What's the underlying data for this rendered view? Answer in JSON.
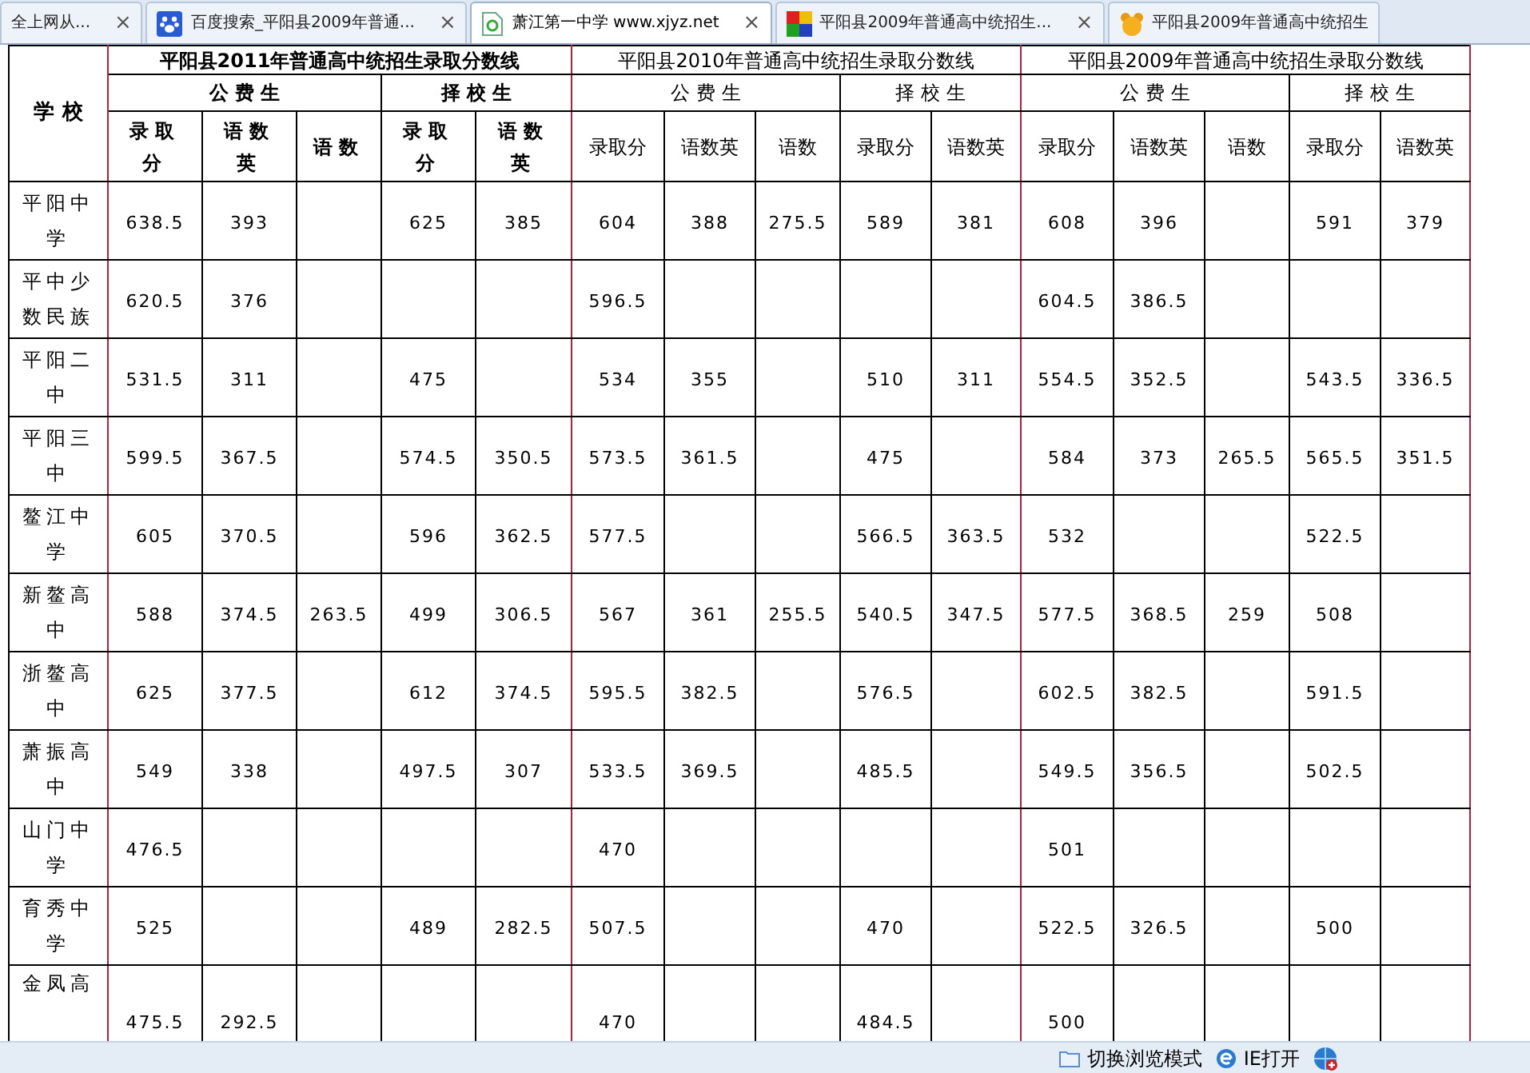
{
  "tabs": [
    {
      "label": "全上网从...",
      "kind": "none",
      "selected": false,
      "closable": true
    },
    {
      "label": "百度搜索_平阳县2009年普通...",
      "kind": "paw",
      "selected": false,
      "closable": true
    },
    {
      "label": "萧江第一中学 www.xjyz.net",
      "kind": "page",
      "selected": true,
      "closable": true
    },
    {
      "label": "平阳县2009年普通高中统招生...",
      "kind": "blocks",
      "selected": false,
      "closable": true
    },
    {
      "label": "平阳县2009年普通高中统招生",
      "kind": "bear",
      "selected": false,
      "closable": false
    }
  ],
  "close_glyph": "×",
  "table": {
    "school_header": "学 校",
    "groups": [
      {
        "title": "平阳县2011年普通高中统招生录取分数线",
        "bold": true,
        "subgroups": [
          {
            "label": "公 费 生",
            "columns": [
              "录取分",
              "语数英",
              "语数"
            ]
          },
          {
            "label": "择 校 生",
            "columns": [
              "录取分",
              "语数英"
            ]
          }
        ]
      },
      {
        "title": "平阳县2010年普通高中统招生录取分数线",
        "bold": false,
        "subgroups": [
          {
            "label": "公 费 生",
            "columns": [
              "录取分",
              "语数英",
              "语数"
            ]
          },
          {
            "label": "择 校 生",
            "columns": [
              "录取分",
              "语数英"
            ]
          }
        ]
      },
      {
        "title": "平阳县2009年普通高中统招生录取分数线",
        "bold": false,
        "subgroups": [
          {
            "label": "公 费 生",
            "columns": [
              "录取分",
              "语数英",
              "语数"
            ]
          },
          {
            "label": "择 校 生",
            "columns": [
              "录取分",
              "语数英"
            ]
          }
        ]
      }
    ],
    "rows": [
      {
        "school": "平阳中学",
        "cells": [
          "638.5",
          "393",
          null,
          "625",
          "385",
          "604",
          "388",
          "275.5",
          "589",
          "381",
          "608",
          "396",
          null,
          "591",
          "379"
        ]
      },
      {
        "school": "平中少数民族",
        "cells": [
          "620.5",
          "376",
          null,
          null,
          null,
          "596.5",
          null,
          null,
          null,
          null,
          "604.5",
          "386.5",
          null,
          null,
          null
        ]
      },
      {
        "school": "平阳二中",
        "cells": [
          "531.5",
          "311",
          null,
          "475",
          null,
          "534",
          "355",
          null,
          "510",
          "311",
          "554.5",
          "352.5",
          null,
          "543.5",
          "336.5"
        ]
      },
      {
        "school": "平阳三中",
        "cells": [
          "599.5",
          "367.5",
          null,
          "574.5",
          "350.5",
          "573.5",
          "361.5",
          null,
          "475",
          null,
          "584",
          "373",
          "265.5",
          "565.5",
          "351.5"
        ]
      },
      {
        "school": "鳌江中学",
        "cells": [
          "605",
          "370.5",
          null,
          "596",
          "362.5",
          "577.5",
          null,
          null,
          "566.5",
          "363.5",
          "532",
          null,
          null,
          "522.5",
          null
        ]
      },
      {
        "school": "新鳌高中",
        "cells": [
          "588",
          "374.5",
          "263.5",
          "499",
          "306.5",
          "567",
          "361",
          "255.5",
          "540.5",
          "347.5",
          "577.5",
          "368.5",
          "259",
          "508",
          null
        ]
      },
      {
        "school": "浙鳌高中",
        "cells": [
          "625",
          "377.5",
          null,
          "612",
          "374.5",
          "595.5",
          "382.5",
          null,
          "576.5",
          null,
          "602.5",
          "382.5",
          null,
          "591.5",
          null
        ]
      },
      {
        "school": "萧振高中",
        "cells": [
          "549",
          "338",
          null,
          "497.5",
          "307",
          "533.5",
          "369.5",
          null,
          "485.5",
          null,
          "549.5",
          "356.5",
          null,
          "502.5",
          null
        ]
      },
      {
        "school": "山门中学",
        "cells": [
          "476.5",
          null,
          null,
          null,
          null,
          "470",
          null,
          null,
          null,
          null,
          "501",
          null,
          null,
          null,
          null
        ]
      },
      {
        "school": "育秀中学",
        "cells": [
          "525",
          null,
          null,
          "489",
          "282.5",
          "507.5",
          null,
          null,
          "470",
          null,
          "522.5",
          "326.5",
          null,
          "500",
          null
        ]
      },
      {
        "school": "金凤高",
        "cells": [
          "475.5",
          "292.5",
          null,
          null,
          null,
          "470",
          null,
          null,
          "484.5",
          null,
          "500",
          null,
          null,
          null,
          null
        ]
      }
    ]
  },
  "status_bar": {
    "items": [
      {
        "label": "切换浏览模式",
        "kind": "folder"
      },
      {
        "label": "IE打开",
        "kind": "ie"
      },
      {
        "kind": "globe"
      }
    ]
  }
}
